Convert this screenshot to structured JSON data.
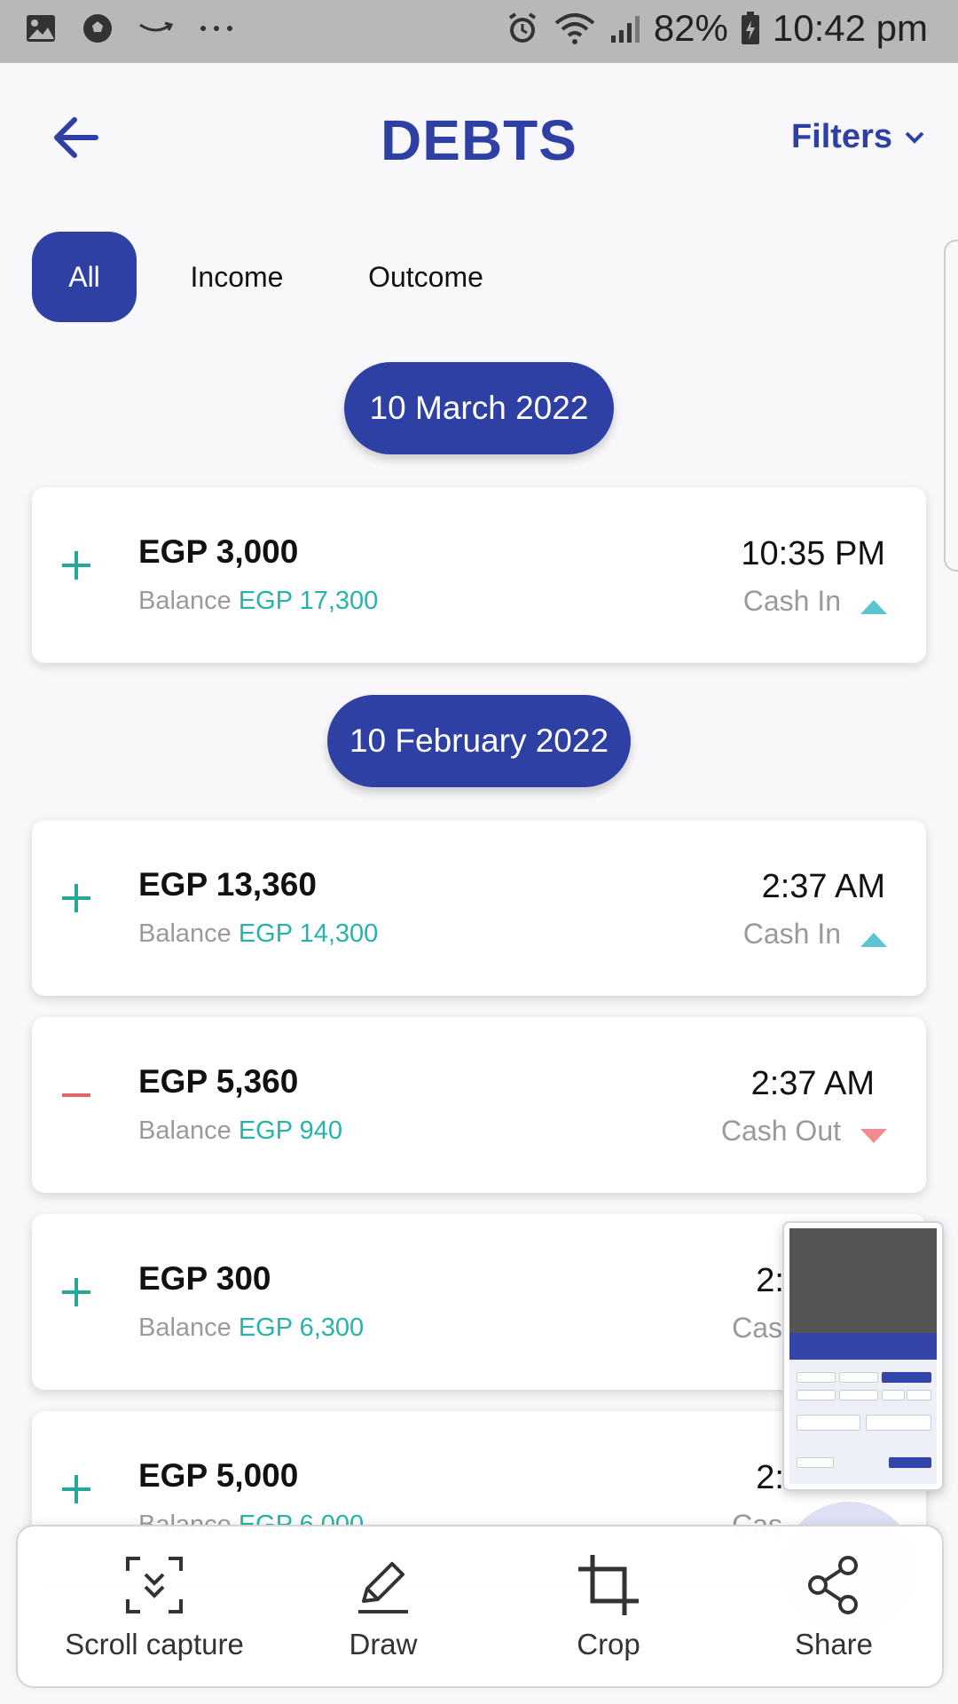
{
  "statusbar": {
    "battery": "82%",
    "time": "10:42 pm",
    "left_icons": [
      "gallery-icon",
      "soccer-ball-icon",
      "amazon-icon",
      "more-icon"
    ]
  },
  "header": {
    "title": "DEBTS",
    "filters_label": "Filters"
  },
  "tabs": [
    {
      "label": "All",
      "active": true
    },
    {
      "label": "Income",
      "active": false
    },
    {
      "label": "Outcome",
      "active": false
    }
  ],
  "groups": [
    {
      "date": "10 March 2022",
      "entries": [
        {
          "sign": "+",
          "amount": "EGP 3,000",
          "balance_label": "Balance",
          "balance": "EGP 17,300",
          "time": "10:35 PM",
          "type": "Cash In",
          "direction": "up"
        }
      ]
    },
    {
      "date": "10 February 2022",
      "entries": [
        {
          "sign": "+",
          "amount": "EGP 13,360",
          "balance_label": "Balance",
          "balance": "EGP 14,300",
          "time": "2:37 AM",
          "type": "Cash In",
          "direction": "up"
        },
        {
          "sign": "-",
          "amount": "EGP 5,360",
          "balance_label": "Balance",
          "balance": "EGP 940",
          "time": "2:37 AM",
          "type": "Cash Out",
          "direction": "down"
        },
        {
          "sign": "+",
          "amount": "EGP 300",
          "balance_label": "Balance",
          "balance": "EGP 6,300",
          "time": "2:",
          "type": "Cas",
          "direction": "up"
        },
        {
          "sign": "+",
          "amount": "EGP 5,000",
          "balance_label": "Balance",
          "balance": "EGP 6,000",
          "time": "2:",
          "type": "Cas",
          "direction": "up"
        }
      ]
    }
  ],
  "toolbar": {
    "scroll_capture": "Scroll capture",
    "draw": "Draw",
    "crop": "Crop",
    "share": "Share"
  },
  "colors": {
    "primary": "#2f40a5",
    "income_green": "#27a69a",
    "outcome_red": "#e0666c",
    "balance_teal": "#27b3ad"
  }
}
